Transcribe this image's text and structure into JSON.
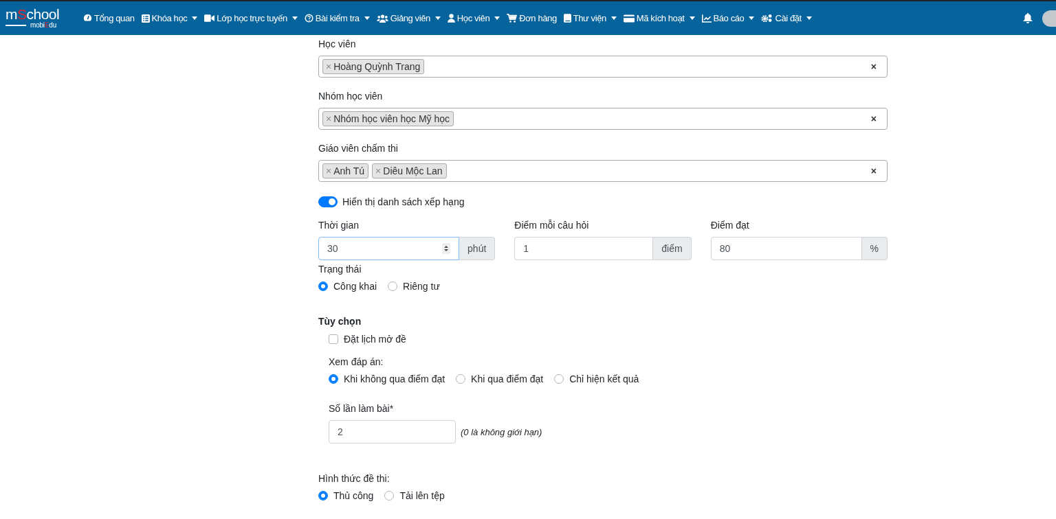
{
  "navbar": {
    "logo": {
      "main": [
        {
          "text": "m",
          "accent": false
        },
        {
          "text": "S",
          "accent": true
        },
        {
          "text": "chool",
          "accent": false
        }
      ],
      "sub": [
        {
          "text": "mobi",
          "accent": false
        },
        {
          "text": "E",
          "accent": true
        },
        {
          "text": "du",
          "accent": false
        }
      ]
    },
    "items": [
      {
        "label": "Tổng quan",
        "dropdown": false
      },
      {
        "label": "Khóa học",
        "dropdown": true
      },
      {
        "label": "Lớp học trực tuyến",
        "dropdown": true
      },
      {
        "label": "Bài kiểm tra",
        "dropdown": true
      },
      {
        "label": "Giảng viên",
        "dropdown": true
      },
      {
        "label": "Học viên",
        "dropdown": true
      },
      {
        "label": "Đơn hàng",
        "dropdown": false
      },
      {
        "label": "Thư viện",
        "dropdown": true
      },
      {
        "label": "Mã kích hoạt",
        "dropdown": true
      },
      {
        "label": "Báo cáo",
        "dropdown": true
      },
      {
        "label": "Cài đặt",
        "dropdown": true
      }
    ]
  },
  "form": [
    {
      "kind": "tags",
      "label": "Học viên",
      "tags": [
        {
          "remove": "×",
          "label": "Hoàng Quỳnh Trang"
        }
      ],
      "clear": "×"
    },
    {
      "kind": "tags",
      "label": "Nhóm học viên",
      "tags": [
        {
          "remove": "×",
          "label": "Nhóm học viên học Mỹ học"
        }
      ],
      "clear": "×"
    },
    {
      "kind": "tags",
      "label": "Giáo viên chấm thi",
      "tags": [
        {
          "remove": "×",
          "label": "Anh Tú"
        },
        {
          "remove": "×",
          "label": "Diêu Mộc Lan"
        }
      ],
      "clear": "×"
    },
    {
      "kind": "switch",
      "label": "Hiển thị danh sách xếp hạng",
      "on": true
    },
    {
      "kind": "inputs",
      "fields": [
        {
          "label": "Thời gian",
          "value": "30",
          "addon": "phút",
          "spinner": true,
          "focused": true
        },
        {
          "label": "Điểm mỗi câu hỏi",
          "value": "1",
          "addon": "điểm",
          "spinner": false,
          "focused": false
        },
        {
          "label": "Điểm đạt",
          "value": "80",
          "addon": "%",
          "spinner": false,
          "focused": false
        }
      ]
    },
    {
      "kind": "radios",
      "label": "Trạng thái",
      "indent": false,
      "options": [
        {
          "label": "Công khai",
          "selected": true
        },
        {
          "label": "Riêng tư",
          "selected": false
        }
      ]
    },
    {
      "kind": "heading",
      "label": "Tùy chọn"
    },
    {
      "kind": "checkbox",
      "label": "Đặt lịch mở đề",
      "checked": false
    },
    {
      "kind": "radios",
      "label": "Xem đáp án:",
      "indent": true,
      "options": [
        {
          "label": "Khi không qua điểm đạt",
          "selected": true
        },
        {
          "label": "Khi qua điểm đạt",
          "selected": false
        },
        {
          "label": "Chỉ hiện kết quả",
          "selected": false
        }
      ]
    },
    {
      "kind": "number",
      "label": "Số lần làm bài*",
      "value": "2",
      "hint": "(0 là không giới hạn)"
    },
    {
      "kind": "radios",
      "label": "Hình thức đề thi:",
      "indent": false,
      "options": [
        {
          "label": "Thủ công",
          "selected": true
        },
        {
          "label": "Tải lên tệp",
          "selected": false
        }
      ]
    }
  ]
}
